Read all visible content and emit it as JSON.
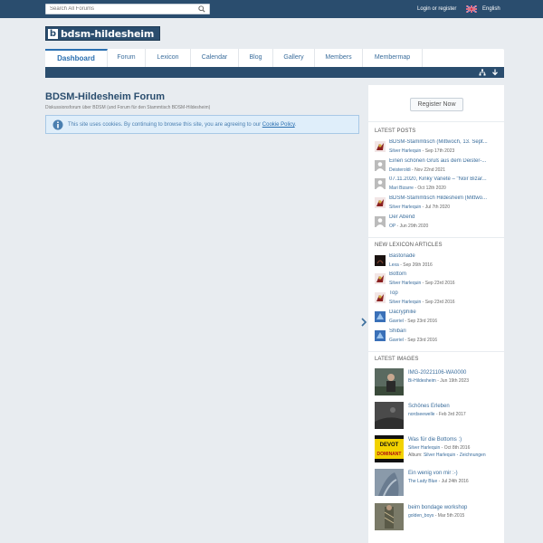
{
  "header": {
    "search_placeholder": "Search All Forums",
    "login_label": "Login or register",
    "language_label": "English"
  },
  "logo": {
    "text": "bdsm-hildesheim"
  },
  "nav": {
    "tabs": [
      "Dashboard",
      "Forum",
      "Lexicon",
      "Calendar",
      "Blog",
      "Gallery",
      "Members",
      "Membermap"
    ]
  },
  "page": {
    "title": "BDSM-Hildesheim Forum",
    "subtitle": "Diskussionsforum über BDSM (und Forum für den Stammtisch BDSM-Hildesheim)",
    "notice_text": "This site uses cookies. By continuing to browse this site, you are agreeing to our ",
    "notice_link": "Cookie Policy",
    "notice_end": "."
  },
  "sidebar": {
    "register_label": "Register Now",
    "latest_posts_title": "LATEST POSTS",
    "latest_posts": [
      {
        "title": "BDSM-Stammtisch (Mittwoch, 13. Sept...",
        "user": "Silver Harlequin",
        "date": " - Sep 17th 2023"
      },
      {
        "title": "Einen schönen Gruß aus dem Deister-...",
        "user": "Deisteroldi",
        "date": " - Nov 22nd 2021"
      },
      {
        "title": "07.11.2020, Kinky Varieté – \"Noir Bizar...",
        "user": "Mari Bizarre",
        "date": " - Oct 12th 2020"
      },
      {
        "title": "BDSM-Stammtisch Hildesheim (Mittwo...",
        "user": "Silver Harlequin",
        "date": " - Jul 7th 2020"
      },
      {
        "title": "Der Abend",
        "user": "OP",
        "date": " - Jun 29th 2020"
      }
    ],
    "lexicon_title": "NEW LEXICON ARTICLES",
    "lexicon": [
      {
        "title": "Bastonade",
        "user": "Lexa",
        "date": " - Sep 26th 2016"
      },
      {
        "title": "Bottom",
        "user": "Silver Harlequin",
        "date": " - Sep 23rd 2016"
      },
      {
        "title": "Top",
        "user": "Silver Harlequin",
        "date": " - Sep 23rd 2016"
      },
      {
        "title": "Dacryphilie",
        "user": "Gavriel",
        "date": " - Sep 23rd 2016"
      },
      {
        "title": "Shibari",
        "user": "Gavriel",
        "date": " - Sep 23rd 2016"
      }
    ],
    "images_title": "LATEST IMAGES",
    "images": [
      {
        "title": "IMG-20221106-WA0000",
        "user": "Bi-Hildesheim",
        "date": " - Jun 19th 2023",
        "album_label": "",
        "album": ""
      },
      {
        "title": "Schönes Erleben",
        "user": "nordseewelle",
        "date": " - Feb 3rd 2017",
        "album_label": "",
        "album": ""
      },
      {
        "title": "Was für die Bottoms :)",
        "user": "Silver Harlequin",
        "date": " - Oct 8th 2016",
        "album_label": "Album: ",
        "album": "Silver Harlequin - Zeichnungen"
      },
      {
        "title": "Ein wenig von mir :-)",
        "user": "The Lady Blue",
        "date": " - Jul 24th 2016",
        "album_label": "",
        "album": ""
      },
      {
        "title": "beim bondage workshop",
        "user": "golden_boys",
        "date": " - Mar 5th 2015",
        "album_label": "",
        "album": ""
      }
    ],
    "devot_text_1": "DEVOT",
    "devot_text_2": "DOMINANT"
  },
  "colors": {
    "brand": "#2a4d6e",
    "link": "#3a6d9c",
    "background": "#e8ecf0",
    "notice_bg": "#dfeefa"
  }
}
